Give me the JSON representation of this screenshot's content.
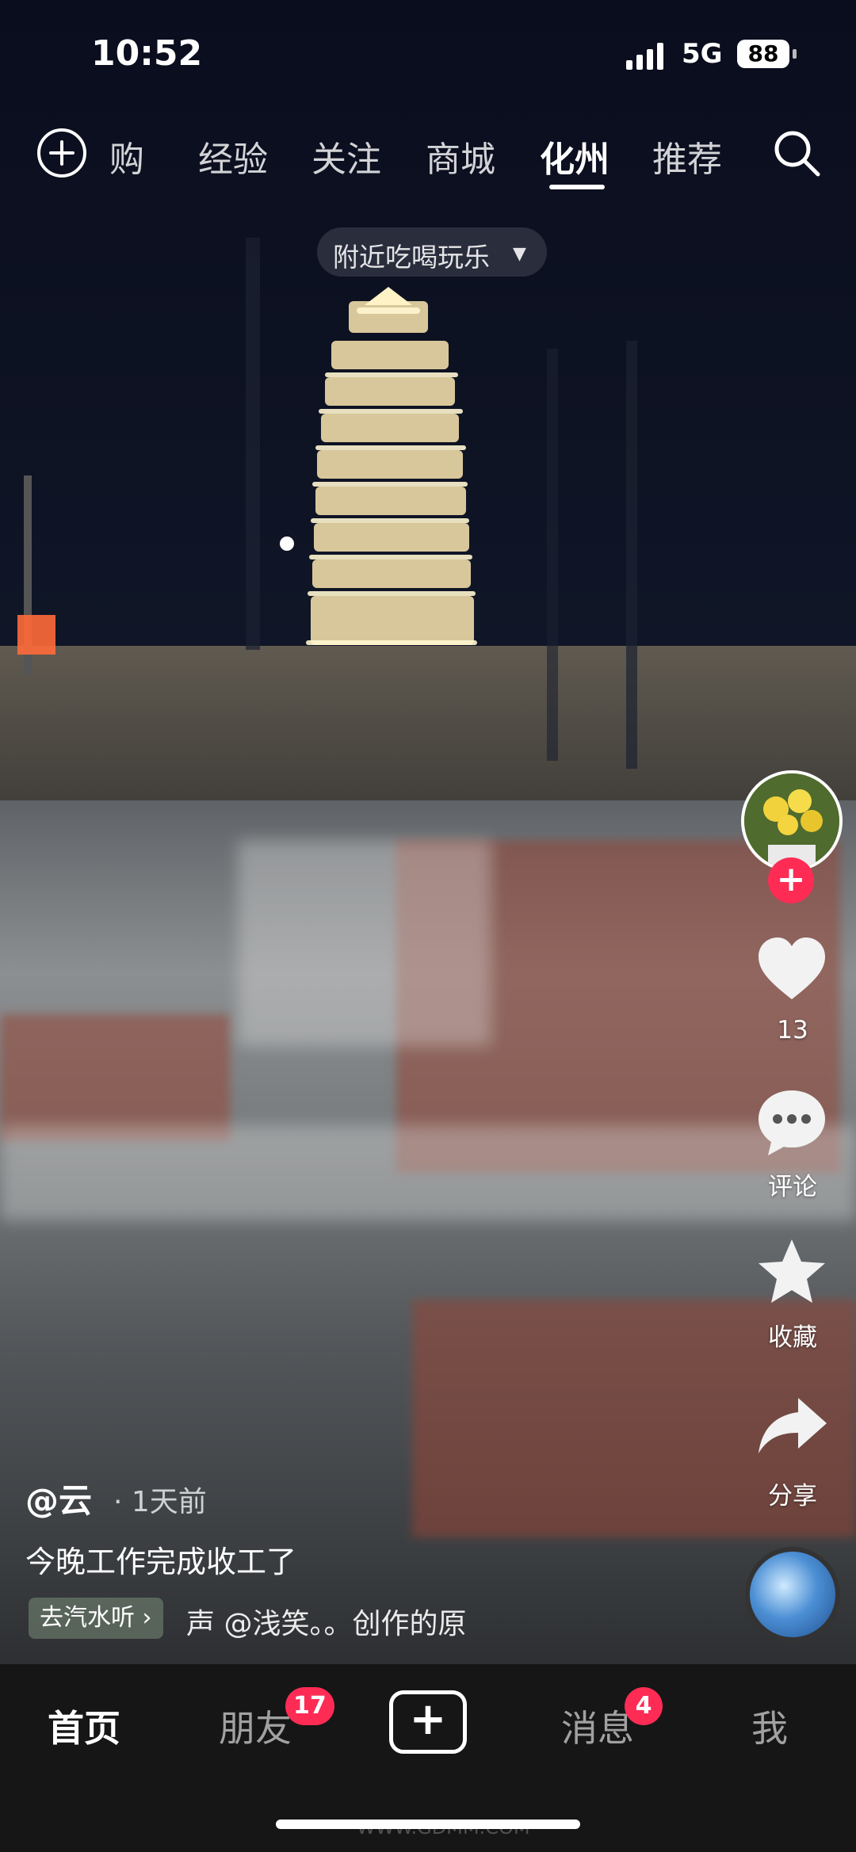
{
  "status_bar": {
    "time": "10:52",
    "network": "5G",
    "battery": "88"
  },
  "top_nav": {
    "tabs": [
      {
        "label": "团购",
        "visible_label": "购",
        "active": false
      },
      {
        "label": "经验",
        "active": false
      },
      {
        "label": "关注",
        "active": false
      },
      {
        "label": "商城",
        "active": false
      },
      {
        "label": "化州",
        "active": true
      },
      {
        "label": "推荐",
        "active": false
      }
    ]
  },
  "nearby_filter": {
    "label": "附近吃喝玩乐"
  },
  "actions": {
    "likes": "13",
    "comment_label": "评论",
    "favorite_label": "收藏",
    "share_label": "分享"
  },
  "post": {
    "author": "@云",
    "time_ago": "· 1天前",
    "caption": "今晚工作完成收工了",
    "music_chip": "去汽水听 ›",
    "music_text": "声    @浅笑。。创作的原"
  },
  "bottom_nav": {
    "home": "首页",
    "friends": "朋友",
    "friends_badge": "17",
    "messages": "消息",
    "messages_badge": "4",
    "me": "我"
  },
  "watermark": "WWW.GDMM.COM",
  "colors": {
    "accent": "#fe2c55",
    "bottom_bar": "#161616"
  }
}
